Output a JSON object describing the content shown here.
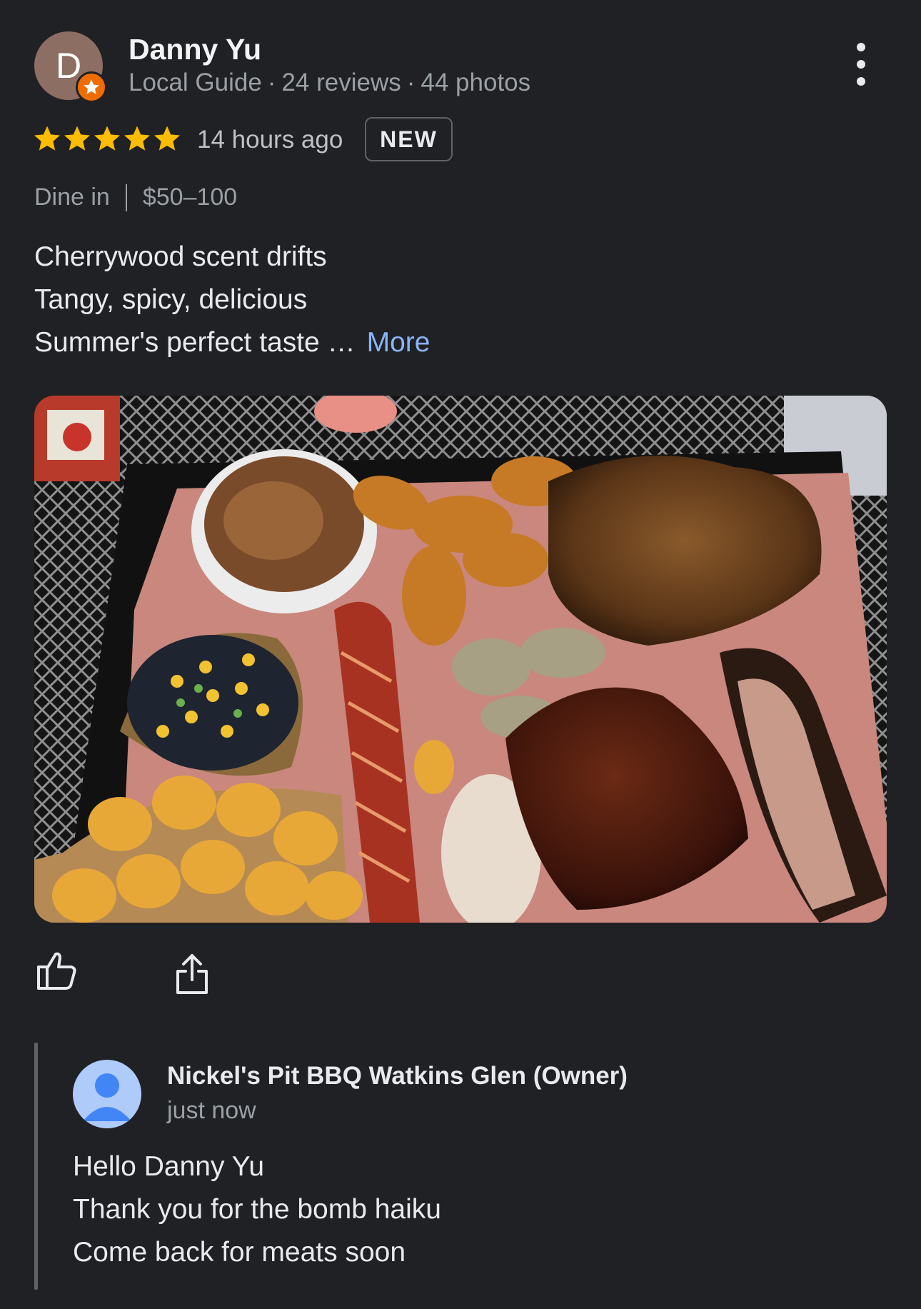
{
  "reviewer": {
    "initial": "D",
    "name": "Danny Yu",
    "role": "Local Guide",
    "reviews": "24 reviews",
    "photos": "44 photos",
    "avatar_color": "#8d6e63",
    "badge_color": "#ef6c00"
  },
  "rating": {
    "stars": 5,
    "max_stars": 5,
    "star_color": "#fbbc04",
    "time": "14 hours ago",
    "badge": "NEW"
  },
  "service": {
    "type": "Dine in",
    "price": "$50–100"
  },
  "review_text": {
    "line1": "Cherrywood scent drifts",
    "line2": "Tangy, spicy, delicious",
    "line3": "Summer's perfect taste …",
    "more_label": "More",
    "link_color": "#8ab4f8"
  },
  "photo": {
    "subject": "bbq-platter-photo"
  },
  "actions": {
    "like_icon": "thumbs-up-icon",
    "share_icon": "share-icon"
  },
  "owner_reply": {
    "name": "Nickel's Pit BBQ Watkins Glen (Owner)",
    "time": "just now",
    "line1": "Hello Danny Yu",
    "line2": "Thank you for the bomb haiku",
    "line3": "Come back for meats soon",
    "avatar_color": "#aecbfa",
    "avatar_figure_color": "#4285f4"
  }
}
